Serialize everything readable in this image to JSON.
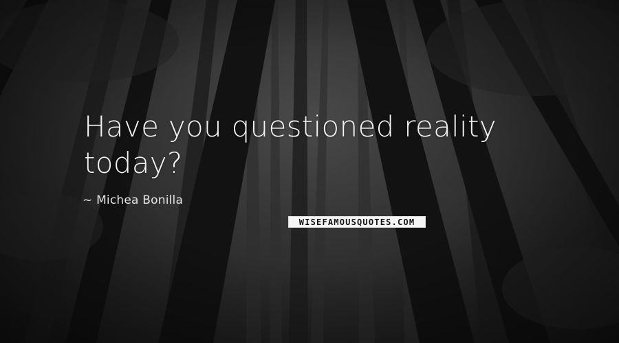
{
  "quote": {
    "line1": "Have you questioned reality",
    "line2": "today?"
  },
  "author": {
    "prefix": "~",
    "name": "Michea Bonilla"
  },
  "watermark": {
    "text": "WISEFAMOUSQUOTES.COM"
  },
  "background": {
    "description_icon": "dark-forest-photo",
    "tone": "#2a2a2a"
  }
}
